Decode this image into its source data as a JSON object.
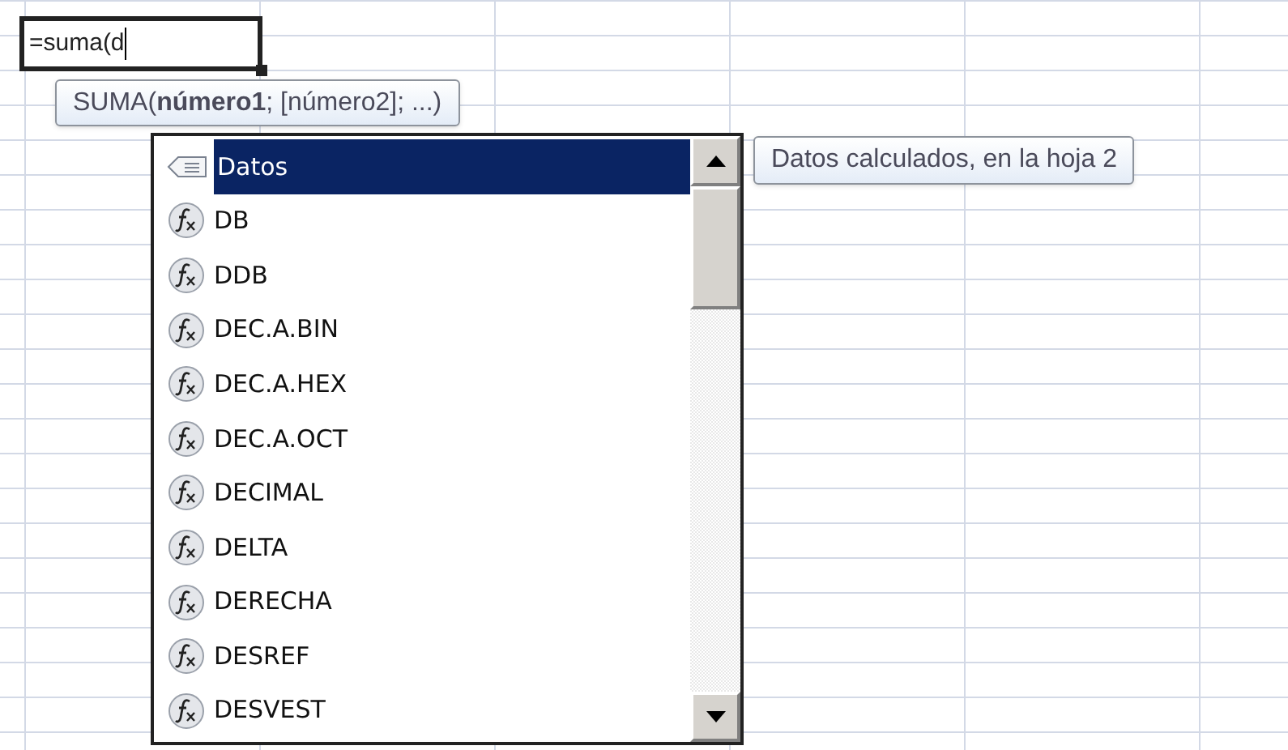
{
  "cell": {
    "value": "=suma(d"
  },
  "tooltip": {
    "function": "SUMA(",
    "args": "**número1**; [número2]; ...)"
  },
  "list": {
    "items": [
      {
        "label": "Datos",
        "kind": "name",
        "selected": true
      },
      {
        "label": "DB",
        "kind": "function",
        "selected": false
      },
      {
        "label": "DDB",
        "kind": "function",
        "selected": false
      },
      {
        "label": "DEC.A.BIN",
        "kind": "function",
        "selected": false
      },
      {
        "label": "DEC.A.HEX",
        "kind": "function",
        "selected": false
      },
      {
        "label": "DEC.A.OCT",
        "kind": "function",
        "selected": false
      },
      {
        "label": "DECIMAL",
        "kind": "function",
        "selected": false
      },
      {
        "label": "DELTA",
        "kind": "function",
        "selected": false
      },
      {
        "label": "DERECHA",
        "kind": "function",
        "selected": false
      },
      {
        "label": "DESREF",
        "kind": "function",
        "selected": false
      },
      {
        "label": "DESVEST",
        "kind": "function",
        "selected": false
      }
    ]
  },
  "item_tip": "Datos calculados, en la hoja 2"
}
